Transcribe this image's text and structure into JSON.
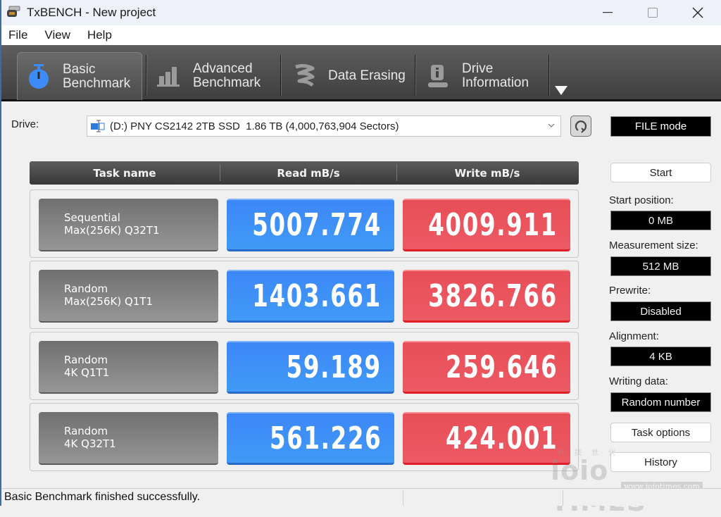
{
  "window": {
    "title": "TxBENCH - New project",
    "controls": {
      "minimize": "—",
      "maximize": "☐",
      "close": "✕"
    }
  },
  "menubar": {
    "items": [
      "File",
      "View",
      "Help"
    ]
  },
  "toolbar": {
    "tabs": [
      {
        "line1": "Basic",
        "line2": "Benchmark",
        "icon": "stopwatch-icon",
        "active": true
      },
      {
        "line1": "Advanced",
        "line2": "Benchmark",
        "icon": "bar-chart-icon",
        "active": false
      },
      {
        "line1": "Data Erasing",
        "line2": "",
        "icon": "eraser-icon",
        "active": false
      },
      {
        "line1": "Drive",
        "line2": "Information",
        "icon": "drive-info-icon",
        "active": false
      }
    ],
    "more_icon": "triangle-down-icon"
  },
  "drive": {
    "label": "Drive:",
    "selected": "(D:) PNY CS2142 2TB SSD  1.86 TB (4,000,763,904 Sectors)",
    "mode": "FILE mode"
  },
  "table": {
    "headers": [
      "Task name",
      "Read mB/s",
      "Write mB/s"
    ],
    "rows": [
      {
        "task_line1": "Sequential",
        "task_line2": "Max(256K) Q32T1",
        "read": "5007.774",
        "write": "4009.911"
      },
      {
        "task_line1": "Random",
        "task_line2": "Max(256K) Q1T1",
        "read": "1403.661",
        "write": "3826.766"
      },
      {
        "task_line1": "Random",
        "task_line2": "4K Q1T1",
        "read": "59.189",
        "write": "259.646"
      },
      {
        "task_line1": "Random",
        "task_line2": "4K Q32T1",
        "read": "561.226",
        "write": "424.001"
      }
    ]
  },
  "side_panel": {
    "start_button": "Start",
    "start_position": {
      "label": "Start position:",
      "value": "0 MB"
    },
    "measurement_size": {
      "label": "Measurement size:",
      "value": "512 MB"
    },
    "prewrite": {
      "label": "Prewrite:",
      "value": "Disabled"
    },
    "alignment": {
      "label": "Alignment:",
      "value": "4 KB"
    },
    "writing_data": {
      "label": "Writing data:",
      "value": "Random number"
    },
    "task_options_button": "Task options",
    "history_button": "History"
  },
  "statusbar": {
    "message": "Basic Benchmark finished successfully."
  },
  "watermark": {
    "brand": "ioio TIMES",
    "url": "www.ioiotimes.com",
    "cjk": "科技世代"
  },
  "colors": {
    "read": "#3f8ff7",
    "write": "#ea545d",
    "task": "#808080",
    "toolbar": "#4f4f4f",
    "active_icon": "#3d8cf5"
  }
}
